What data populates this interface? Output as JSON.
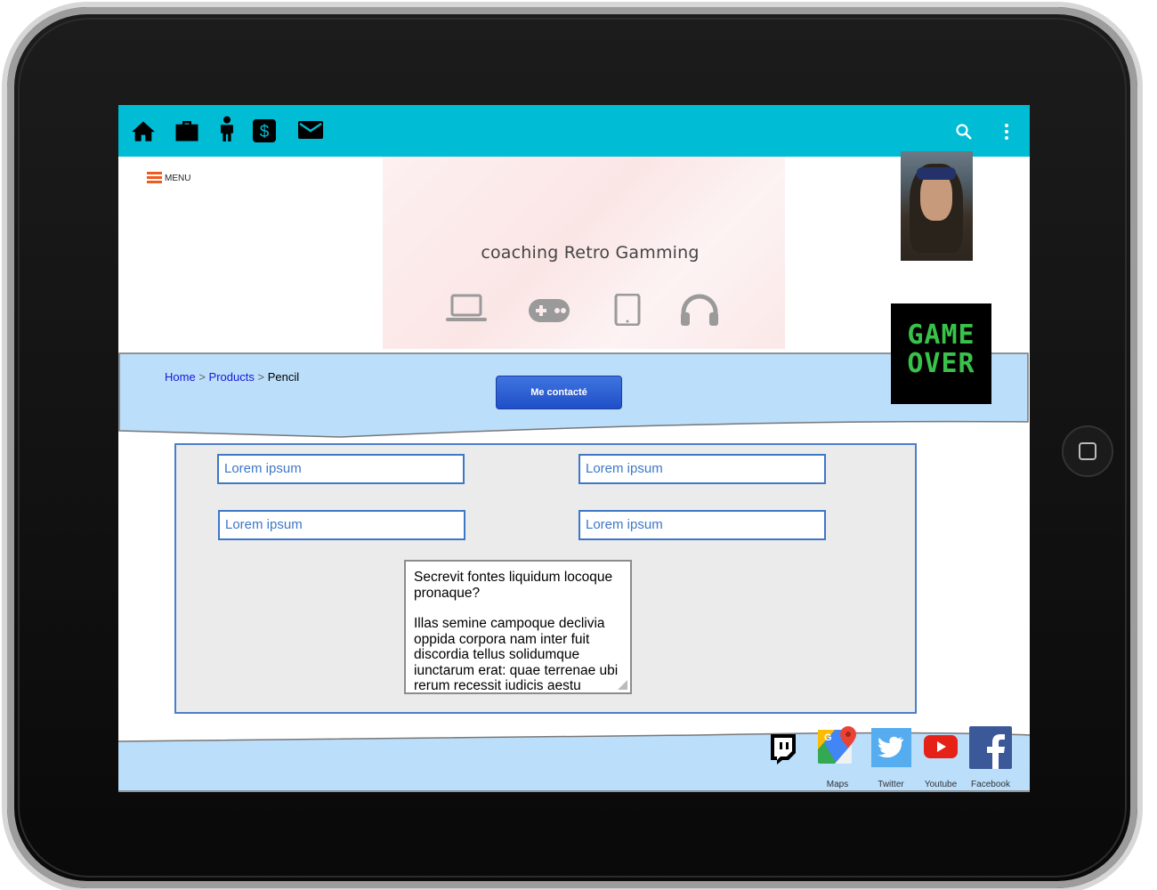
{
  "colors": {
    "appbar": "#00bcd4",
    "menu_accent": "#ef5a1e",
    "banner_fill": "#bbdefb",
    "contact_button": "#2855d1",
    "form_border": "#4a7ec9",
    "link": "#1818d6",
    "game_over_green": "#39c24a"
  },
  "appbar": {
    "left_icons": [
      "home-icon",
      "briefcase-icon",
      "person-icon",
      "dollar-icon",
      "mail-icon"
    ],
    "right_icons": [
      "search-icon",
      "more-vert-icon"
    ]
  },
  "menu": {
    "label": "MENU",
    "icon": "hamburger-icon"
  },
  "hero": {
    "title": "coaching Retro Gamming",
    "icons": [
      "laptop-icon",
      "gamepad-icon",
      "tablet-icon",
      "headphones-icon"
    ]
  },
  "breadcrumb": {
    "items": [
      "Home",
      "Products",
      "Pencil"
    ],
    "separator": ">"
  },
  "contact_button": {
    "label": "Me contacté"
  },
  "game_over": {
    "line1": "GAME",
    "line2": "OVER"
  },
  "form": {
    "inputs": [
      "Lorem ipsum",
      "Lorem ipsum",
      "Lorem ipsum",
      "Lorem ipsum"
    ],
    "textarea": {
      "paragraph1": "Secrevit fontes liquidum locoque pronaque?",
      "paragraph2": "Illas semine campoque declivia oppida corpora nam inter fuit discordia tellus solidumque iunctarum erat: quae terrenae ubi rerum recessit iudicis aestu"
    }
  },
  "footer": {
    "socials": [
      {
        "name": "Twitch",
        "label": "",
        "icon": "twitch-icon"
      },
      {
        "name": "Maps",
        "label": "Maps",
        "icon": "google-maps-icon"
      },
      {
        "name": "Twitter",
        "label": "Twitter",
        "icon": "twitter-icon"
      },
      {
        "name": "Youtube",
        "label": "Youtube",
        "icon": "youtube-icon"
      },
      {
        "name": "Facebook",
        "label": "Facebook",
        "icon": "facebook-icon"
      }
    ]
  }
}
